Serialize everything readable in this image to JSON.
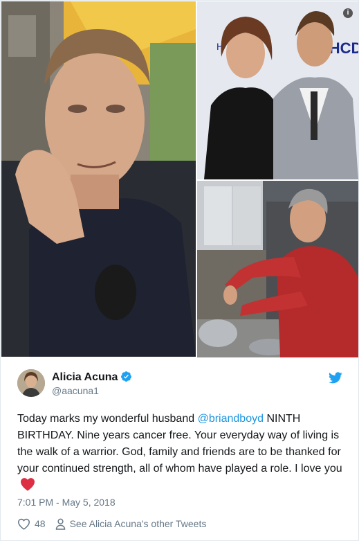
{
  "tweet": {
    "author_name": "Alicia Acuna",
    "handle": "@aacuna1",
    "text_before_mention": "Today marks my wonderful husband ",
    "mention": "@briandboyd",
    "text_after_mention": " NINTH BIRTHDAY. Nine years cancer free. Your everyday way of living is the walk of a warrior. God, family and friends are to be thanked for your continued strength, all of whom have played a role. I love you",
    "timestamp": "7:01 PM - May 5, 2018",
    "like_count": "48",
    "see_other_tweets": "See Alicia Acuna's other Tweets"
  },
  "media": {
    "backdrop_text": "WHCDJ",
    "backdrop_text_left": "H"
  },
  "icons": {
    "info": "info-icon",
    "verified": "verified-badge-icon",
    "twitter": "twitter-bird-icon",
    "like": "heart-outline-icon",
    "person": "person-icon",
    "emoji": "red-heart-emoji"
  },
  "colors": {
    "link": "#1b95e0",
    "text": "#14171a",
    "muted": "#657786",
    "heart_emoji": "#dd2e44"
  }
}
